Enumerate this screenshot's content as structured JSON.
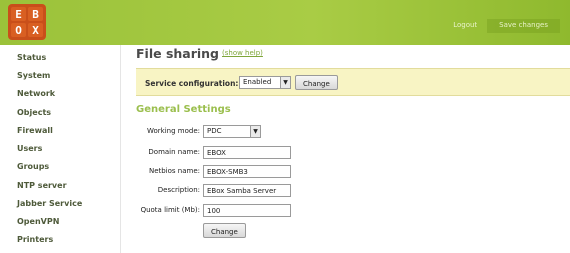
{
  "logo": {
    "top_left": "E",
    "top_right": "B",
    "bottom_left": "O",
    "bottom_right": "X"
  },
  "header": {
    "logout": "Logout",
    "save_changes": "Save changes"
  },
  "sidebar": {
    "items": [
      {
        "label": "Status"
      },
      {
        "label": "System"
      },
      {
        "label": "Network"
      },
      {
        "label": "Objects"
      },
      {
        "label": "Firewall"
      },
      {
        "label": "Users"
      },
      {
        "label": "Groups"
      },
      {
        "label": "NTP server"
      },
      {
        "label": "Jabber Service"
      },
      {
        "label": "OpenVPN"
      },
      {
        "label": "Printers"
      }
    ]
  },
  "page": {
    "title": "File sharing",
    "help_link": "(show help)"
  },
  "service_config": {
    "label": "Service configuration:",
    "selected": "Enabled",
    "change_label": "Change"
  },
  "general_settings": {
    "title": "General Settings",
    "working_mode": {
      "label": "Working mode:",
      "value": "PDC"
    },
    "domain_name": {
      "label": "Domain name:",
      "value": "EBOX"
    },
    "netbios_name": {
      "label": "Netbios name:",
      "value": "EBOX-SMB3"
    },
    "description": {
      "label": "Description:",
      "value": "EBox Samba Server"
    },
    "quota_limit": {
      "label": "Quota limit (Mb):",
      "value": "100"
    },
    "change_label": "Change"
  },
  "icons": {
    "dropdown": "chevron-down-icon"
  },
  "colors": {
    "header_green": "#a9cc45",
    "logo_orange": "#d95f22",
    "section_green": "#9bbf4e",
    "notice_yellow": "#f8f4c4"
  }
}
